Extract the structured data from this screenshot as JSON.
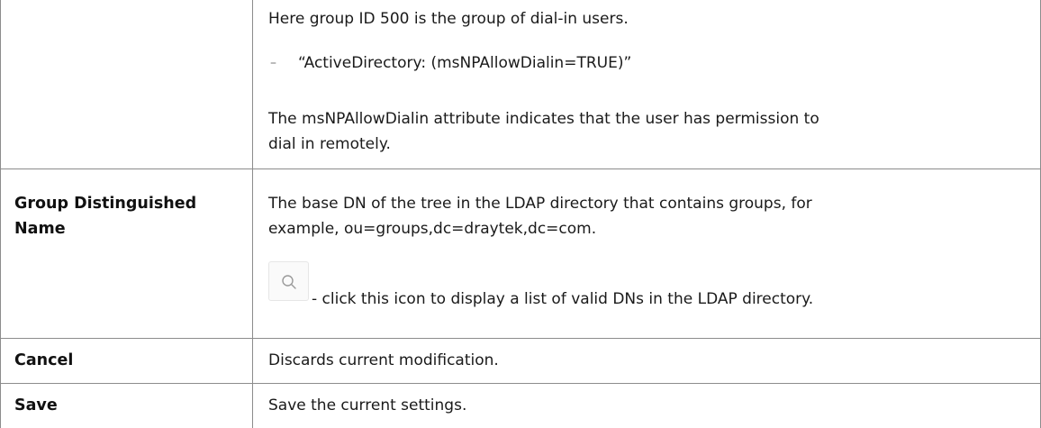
{
  "rows": {
    "filter": {
      "line1": "Here group ID 500 is the group of dial-in users.",
      "bullet_mark": "–",
      "bullet_text": "“ActiveDirectory: (msNPAllowDialin=TRUE)”",
      "para_line1": "The msNPAllowDialin attribute indicates that the user has permission to",
      "para_line2": "dial in remotely."
    },
    "group_dn": {
      "term_line1": "Group Distinguished",
      "term_line2": "Name",
      "desc_line1": "The base DN of the tree in the LDAP directory that contains groups, for",
      "desc_line2": "example, ou=groups,dc=draytek,dc=com.",
      "icon_note": "- click this icon to display a list of valid DNs in the LDAP directory."
    },
    "cancel": {
      "term": "Cancel",
      "desc": "Discards current modification."
    },
    "save": {
      "term": "Save",
      "desc": "Save the current settings."
    }
  },
  "icons": {
    "search": "search-icon"
  }
}
